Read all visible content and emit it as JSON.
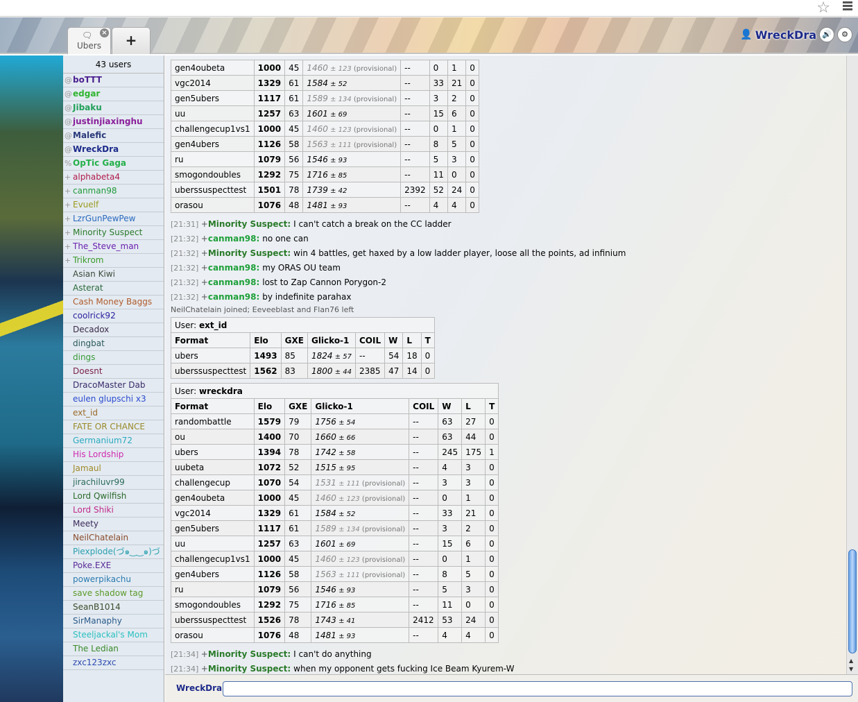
{
  "browser": {
    "bookmark_icon": "star-icon",
    "menu_icon": "hamburger-icon"
  },
  "header": {
    "tabs": [
      {
        "label": "Ubers",
        "icon": "chat-bubble-icon",
        "closable": true
      }
    ],
    "new_tab_label": "+",
    "username": "WreckDra",
    "user_icon": "user-icon",
    "sound_icon": "speaker-icon",
    "settings_icon": "gear-icon"
  },
  "userlist": {
    "count_label": "43 users",
    "users": [
      {
        "group": "@",
        "name": "boTTT",
        "color": "#4b1f8f",
        "auth": true
      },
      {
        "group": "@",
        "name": "edgar",
        "color": "#2fb52f",
        "auth": true
      },
      {
        "group": "@",
        "name": "Jibaku",
        "color": "#22a05a",
        "auth": true
      },
      {
        "group": "@",
        "name": "justinjiaxinghu",
        "color": "#8a1f9a",
        "auth": true
      },
      {
        "group": "@",
        "name": "Malefic",
        "color": "#2a3a7a",
        "auth": true
      },
      {
        "group": "@",
        "name": "WreckDra",
        "color": "#1c2a8a",
        "auth": true
      },
      {
        "group": "%",
        "name": "OpTic Gaga",
        "color": "#24b04a",
        "auth": true
      },
      {
        "group": "+",
        "name": "alphabeta4",
        "color": "#b0194a",
        "auth": false
      },
      {
        "group": "+",
        "name": "canman98",
        "color": "#1f9a3a",
        "auth": false
      },
      {
        "group": "+",
        "name": "Evuelf",
        "color": "#9a9a20",
        "auth": false
      },
      {
        "group": "+",
        "name": "LzrGunPewPew",
        "color": "#2a6ac0",
        "auth": false
      },
      {
        "group": "+",
        "name": "Minority Suspect",
        "color": "#2a7a2a",
        "auth": false
      },
      {
        "group": "+",
        "name": "The_Steve_man",
        "color": "#6a1fb0",
        "auth": false
      },
      {
        "group": "+",
        "name": "Trikrom",
        "color": "#3a9a2a",
        "auth": false
      },
      {
        "group": "",
        "name": "Asian Kiwi",
        "color": "#3a4a3a",
        "auth": false
      },
      {
        "group": "",
        "name": "Asterat",
        "color": "#2a6a3a",
        "auth": false
      },
      {
        "group": "",
        "name": "Cash Money Baggs",
        "color": "#b05a2a",
        "auth": false
      },
      {
        "group": "",
        "name": "coolrick92",
        "color": "#2a20a0",
        "auth": false
      },
      {
        "group": "",
        "name": "Decadox",
        "color": "#3a2a4a",
        "auth": false
      },
      {
        "group": "",
        "name": "dingbat",
        "color": "#2a5a5a",
        "auth": false
      },
      {
        "group": "",
        "name": "dings",
        "color": "#3a9a3a",
        "auth": false
      },
      {
        "group": "",
        "name": "Doesnt",
        "color": "#7a1f4a",
        "auth": false
      },
      {
        "group": "",
        "name": "DracoMaster Dab",
        "color": "#3a2a6a",
        "auth": false
      },
      {
        "group": "",
        "name": "eulen glupschi x3",
        "color": "#2a4ad0",
        "auth": false
      },
      {
        "group": "",
        "name": "ext_id",
        "color": "#9a6a2a",
        "auth": false
      },
      {
        "group": "",
        "name": "FATE OR CHANCE",
        "color": "#9a8a2a",
        "auth": false
      },
      {
        "group": "",
        "name": "Germanium72",
        "color": "#2aaac0",
        "auth": false
      },
      {
        "group": "",
        "name": "His Lordship",
        "color": "#d02ab0",
        "auth": false
      },
      {
        "group": "",
        "name": "Jamaul",
        "color": "#a08a2a",
        "auth": false
      },
      {
        "group": "",
        "name": "jirachiluvr99",
        "color": "#2a6a5a",
        "auth": false
      },
      {
        "group": "",
        "name": "Lord Qwilfish",
        "color": "#2a6a2a",
        "auth": false
      },
      {
        "group": "",
        "name": "Lord Shiki",
        "color": "#c02a8a",
        "auth": false
      },
      {
        "group": "",
        "name": "Meety",
        "color": "#3a2a5a",
        "auth": false
      },
      {
        "group": "",
        "name": "NeilChatelain",
        "color": "#8a4a2a",
        "auth": false
      },
      {
        "group": "",
        "name": "Piexplode(づ๑‿‿๑)づ",
        "color": "#2aa0b0",
        "auth": false
      },
      {
        "group": "",
        "name": "Poke.EXE",
        "color": "#5a2a9a",
        "auth": false
      },
      {
        "group": "",
        "name": "powerpikachu",
        "color": "#2a7ab0",
        "auth": false
      },
      {
        "group": "",
        "name": "save shadow tag",
        "color": "#5a9a2a",
        "auth": false
      },
      {
        "group": "",
        "name": "SeanB1014",
        "color": "#3a4a2a",
        "auth": false
      },
      {
        "group": "",
        "name": "SirManaphy",
        "color": "#2a5a8a",
        "auth": false
      },
      {
        "group": "",
        "name": "Steeljackal's Mom",
        "color": "#2ac0c0",
        "auth": false
      },
      {
        "group": "",
        "name": "The Ledian",
        "color": "#3a8a2a",
        "auth": false
      },
      {
        "group": "",
        "name": "zxc123zxc",
        "color": "#2a4ab0",
        "auth": false
      }
    ]
  },
  "chat": {
    "table_headers": [
      "Format",
      "Elo",
      "GXE",
      "Glicko-1",
      "COIL",
      "W",
      "L",
      "T"
    ],
    "provisional_label": "(provisional)",
    "top_table_rows": [
      {
        "format": "gen4oubeta",
        "elo": "1000",
        "gxe": "45",
        "glicko": "1460",
        "dev": "123",
        "prov": true,
        "coil": "--",
        "w": "0",
        "l": "1",
        "t": "0"
      },
      {
        "format": "vgc2014",
        "elo": "1329",
        "gxe": "61",
        "glicko": "1584",
        "dev": "52",
        "prov": false,
        "coil": "--",
        "w": "33",
        "l": "21",
        "t": "0"
      },
      {
        "format": "gen5ubers",
        "elo": "1117",
        "gxe": "61",
        "glicko": "1589",
        "dev": "134",
        "prov": true,
        "coil": "--",
        "w": "3",
        "l": "2",
        "t": "0"
      },
      {
        "format": "uu",
        "elo": "1257",
        "gxe": "63",
        "glicko": "1601",
        "dev": "69",
        "prov": false,
        "coil": "--",
        "w": "15",
        "l": "6",
        "t": "0"
      },
      {
        "format": "challengecup1vs1",
        "elo": "1000",
        "gxe": "45",
        "glicko": "1460",
        "dev": "123",
        "prov": true,
        "coil": "--",
        "w": "0",
        "l": "1",
        "t": "0"
      },
      {
        "format": "gen4ubers",
        "elo": "1126",
        "gxe": "58",
        "glicko": "1563",
        "dev": "111",
        "prov": true,
        "coil": "--",
        "w": "8",
        "l": "5",
        "t": "0"
      },
      {
        "format": "ru",
        "elo": "1079",
        "gxe": "56",
        "glicko": "1546",
        "dev": "93",
        "prov": false,
        "coil": "--",
        "w": "5",
        "l": "3",
        "t": "0"
      },
      {
        "format": "smogondoubles",
        "elo": "1292",
        "gxe": "75",
        "glicko": "1716",
        "dev": "85",
        "prov": false,
        "coil": "--",
        "w": "11",
        "l": "0",
        "t": "0"
      },
      {
        "format": "uberssuspecttest",
        "elo": "1501",
        "gxe": "78",
        "glicko": "1739",
        "dev": "42",
        "prov": false,
        "coil": "2392",
        "w": "52",
        "l": "24",
        "t": "0"
      },
      {
        "format": "orasou",
        "elo": "1076",
        "gxe": "48",
        "glicko": "1481",
        "dev": "93",
        "prov": false,
        "coil": "--",
        "w": "4",
        "l": "4",
        "t": "0"
      }
    ],
    "messages_1": [
      {
        "time": "[21:31]",
        "group": "+",
        "user": "Minority Suspect",
        "color": "#2a7a2a",
        "text": "I can't catch a break on the CC ladder"
      },
      {
        "time": "[21:32]",
        "group": "+",
        "user": "canman98",
        "color": "#1fa03a",
        "text": "no one can"
      },
      {
        "time": "[21:32]",
        "group": "+",
        "user": "Minority Suspect",
        "color": "#2a7a2a",
        "text": "win 4 battles, get haxed by a low ladder player, loose all the points, ad infinium"
      },
      {
        "time": "[21:32]",
        "group": "+",
        "user": "canman98",
        "color": "#1fa03a",
        "text": "my ORAS OU team"
      },
      {
        "time": "[21:32]",
        "group": "+",
        "user": "canman98",
        "color": "#1fa03a",
        "text": "lost to Zap Cannon Porygon-2"
      },
      {
        "time": "[21:32]",
        "group": "+",
        "user": "canman98",
        "color": "#1fa03a",
        "text": "by indefinite parahax"
      }
    ],
    "join_notice": "NeilChatelain joined; Eeveeblast and Flan76 left",
    "ext_id_table": {
      "user_label": "User:",
      "user": "ext_id",
      "rows": [
        {
          "format": "ubers",
          "elo": "1493",
          "gxe": "85",
          "glicko": "1824",
          "dev": "57",
          "prov": false,
          "coil": "--",
          "w": "54",
          "l": "18",
          "t": "0"
        },
        {
          "format": "uberssuspecttest",
          "elo": "1562",
          "gxe": "83",
          "glicko": "1800",
          "dev": "44",
          "prov": false,
          "coil": "2385",
          "w": "47",
          "l": "14",
          "t": "0"
        }
      ]
    },
    "wreckdra_table": {
      "user_label": "User:",
      "user": "wreckdra",
      "rows": [
        {
          "format": "randombattle",
          "elo": "1579",
          "gxe": "79",
          "glicko": "1756",
          "dev": "54",
          "prov": false,
          "coil": "--",
          "w": "63",
          "l": "27",
          "t": "0"
        },
        {
          "format": "ou",
          "elo": "1400",
          "gxe": "70",
          "glicko": "1660",
          "dev": "66",
          "prov": false,
          "coil": "--",
          "w": "63",
          "l": "44",
          "t": "0"
        },
        {
          "format": "ubers",
          "elo": "1394",
          "gxe": "78",
          "glicko": "1742",
          "dev": "58",
          "prov": false,
          "coil": "--",
          "w": "245",
          "l": "175",
          "t": "1"
        },
        {
          "format": "uubeta",
          "elo": "1072",
          "gxe": "52",
          "glicko": "1515",
          "dev": "95",
          "prov": false,
          "coil": "--",
          "w": "4",
          "l": "3",
          "t": "0"
        },
        {
          "format": "challengecup",
          "elo": "1070",
          "gxe": "54",
          "glicko": "1531",
          "dev": "111",
          "prov": true,
          "coil": "--",
          "w": "3",
          "l": "3",
          "t": "0"
        },
        {
          "format": "gen4oubeta",
          "elo": "1000",
          "gxe": "45",
          "glicko": "1460",
          "dev": "123",
          "prov": true,
          "coil": "--",
          "w": "0",
          "l": "1",
          "t": "0"
        },
        {
          "format": "vgc2014",
          "elo": "1329",
          "gxe": "61",
          "glicko": "1584",
          "dev": "52",
          "prov": false,
          "coil": "--",
          "w": "33",
          "l": "21",
          "t": "0"
        },
        {
          "format": "gen5ubers",
          "elo": "1117",
          "gxe": "61",
          "glicko": "1589",
          "dev": "134",
          "prov": true,
          "coil": "--",
          "w": "3",
          "l": "2",
          "t": "0"
        },
        {
          "format": "uu",
          "elo": "1257",
          "gxe": "63",
          "glicko": "1601",
          "dev": "69",
          "prov": false,
          "coil": "--",
          "w": "15",
          "l": "6",
          "t": "0"
        },
        {
          "format": "challengecup1vs1",
          "elo": "1000",
          "gxe": "45",
          "glicko": "1460",
          "dev": "123",
          "prov": true,
          "coil": "--",
          "w": "0",
          "l": "1",
          "t": "0"
        },
        {
          "format": "gen4ubers",
          "elo": "1126",
          "gxe": "58",
          "glicko": "1563",
          "dev": "111",
          "prov": true,
          "coil": "--",
          "w": "8",
          "l": "5",
          "t": "0"
        },
        {
          "format": "ru",
          "elo": "1079",
          "gxe": "56",
          "glicko": "1546",
          "dev": "93",
          "prov": false,
          "coil": "--",
          "w": "5",
          "l": "3",
          "t": "0"
        },
        {
          "format": "smogondoubles",
          "elo": "1292",
          "gxe": "75",
          "glicko": "1716",
          "dev": "85",
          "prov": false,
          "coil": "--",
          "w": "11",
          "l": "0",
          "t": "0"
        },
        {
          "format": "uberssuspecttest",
          "elo": "1526",
          "gxe": "78",
          "glicko": "1743",
          "dev": "41",
          "prov": false,
          "coil": "2412",
          "w": "53",
          "l": "24",
          "t": "0"
        },
        {
          "format": "orasou",
          "elo": "1076",
          "gxe": "48",
          "glicko": "1481",
          "dev": "93",
          "prov": false,
          "coil": "--",
          "w": "4",
          "l": "4",
          "t": "0"
        }
      ]
    },
    "messages_2": [
      {
        "time": "[21:34]",
        "group": "+",
        "user": "Minority Suspect",
        "color": "#2a7a2a",
        "text": "I can't do anything"
      },
      {
        "time": "[21:34]",
        "group": "+",
        "user": "Minority Suspect",
        "color": "#2a7a2a",
        "text": "when my opponent gets fucking Ice Beam Kyurem-W"
      }
    ]
  },
  "compose": {
    "label": "WreckDra:",
    "value": "",
    "placeholder": ""
  },
  "scrollbar": {
    "position_fraction": 0.95
  }
}
